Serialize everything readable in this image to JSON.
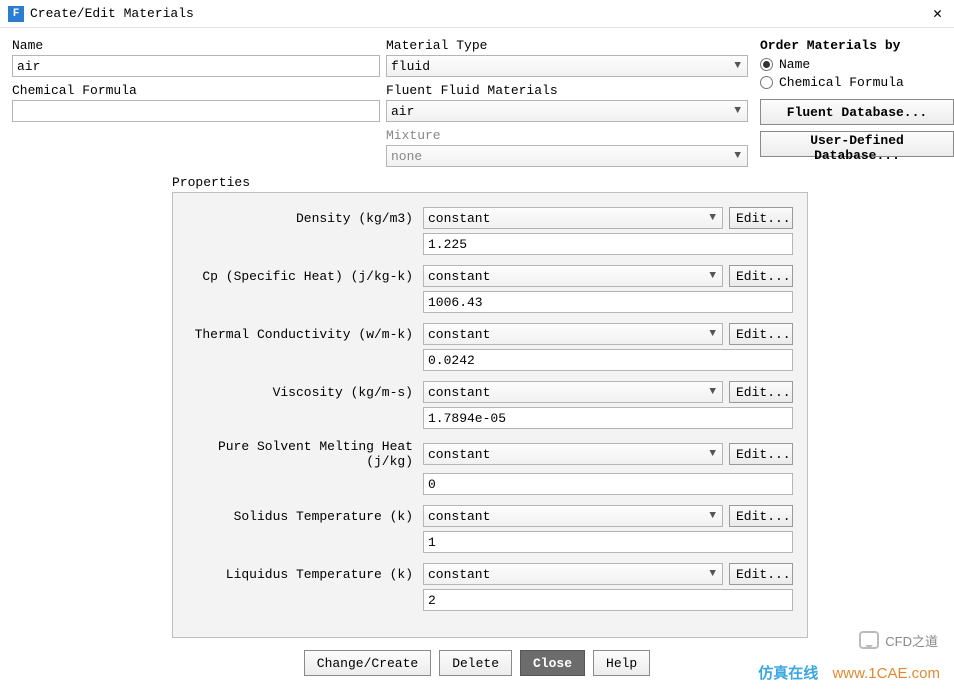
{
  "window": {
    "title": "Create/Edit Materials"
  },
  "left": {
    "name_label": "Name",
    "name_value": "air",
    "formula_label": "Chemical Formula",
    "formula_value": ""
  },
  "mid": {
    "type_label": "Material Type",
    "type_value": "fluid",
    "fluid_label": "Fluent Fluid Materials",
    "fluid_value": "air",
    "mixture_label": "Mixture",
    "mixture_value": "none"
  },
  "order": {
    "title": "Order Materials by",
    "opt1": "Name",
    "opt2": "Chemical Formula"
  },
  "db": {
    "fluent": "Fluent Database...",
    "user": "User-Defined Database..."
  },
  "props_label": "Properties",
  "edit_label": "Edit...",
  "props": [
    {
      "label": "Density (kg/m3)",
      "method": "constant",
      "value": "1.225"
    },
    {
      "label": "Cp (Specific Heat) (j/kg-k)",
      "method": "constant",
      "value": "1006.43"
    },
    {
      "label": "Thermal Conductivity (w/m-k)",
      "method": "constant",
      "value": "0.0242"
    },
    {
      "label": "Viscosity (kg/m-s)",
      "method": "constant",
      "value": "1.7894e-05"
    },
    {
      "label": "Pure Solvent Melting Heat (j/kg)",
      "method": "constant",
      "value": "0"
    },
    {
      "label": "Solidus Temperature (k)",
      "method": "constant",
      "value": "1"
    },
    {
      "label": "Liquidus Temperature (k)",
      "method": "constant",
      "value": "2"
    }
  ],
  "buttons": {
    "change": "Change/Create",
    "delete": "Delete",
    "close": "Close",
    "help": "Help"
  },
  "watermark": {
    "badge": "CFD之道",
    "line_a": "仿真在线",
    "line_b": "www.1CAE.com"
  }
}
